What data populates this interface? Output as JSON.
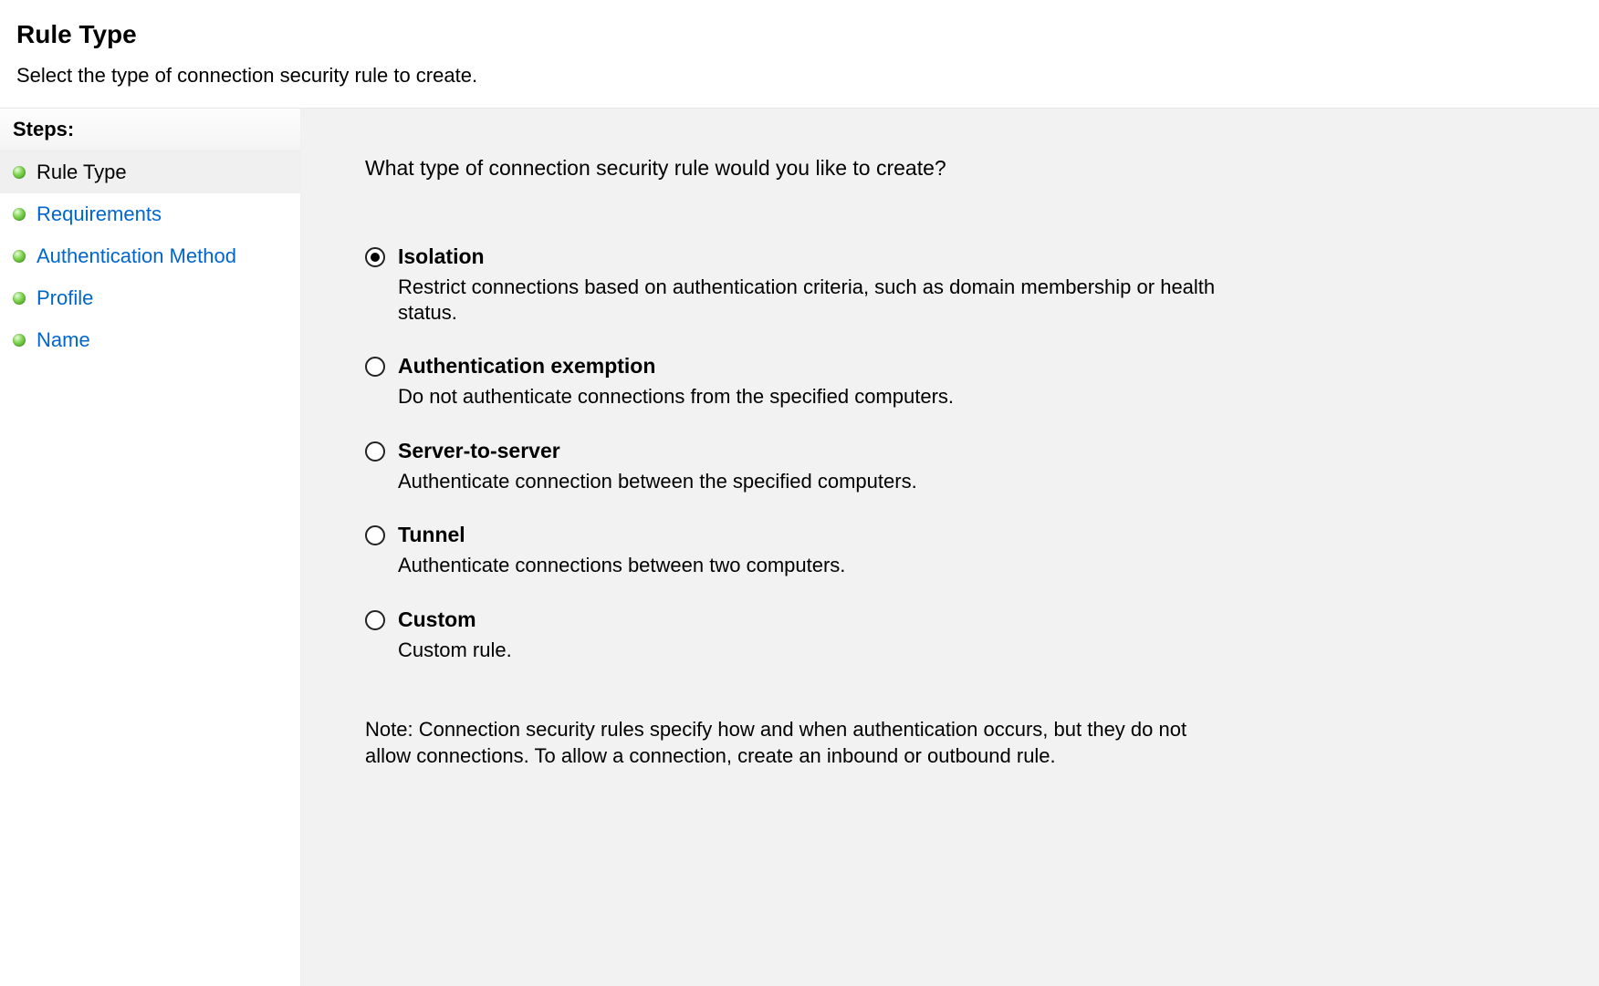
{
  "header": {
    "title": "Rule Type",
    "subtitle": "Select the type of connection security rule to create."
  },
  "sidebar": {
    "heading": "Steps:",
    "items": [
      {
        "label": "Rule Type"
      },
      {
        "label": "Requirements"
      },
      {
        "label": "Authentication Method"
      },
      {
        "label": "Profile"
      },
      {
        "label": "Name"
      }
    ]
  },
  "main": {
    "question": "What type of connection security rule would you like to create?",
    "options": [
      {
        "title": "Isolation",
        "desc": "Restrict connections based on authentication criteria, such as domain membership or health status."
      },
      {
        "title": "Authentication exemption",
        "desc": "Do not authenticate connections from the specified computers."
      },
      {
        "title": "Server-to-server",
        "desc": "Authenticate connection between the specified computers."
      },
      {
        "title": "Tunnel",
        "desc": "Authenticate connections between two computers."
      },
      {
        "title": "Custom",
        "desc": "Custom rule."
      }
    ],
    "note": "Note:  Connection security rules specify how and when authentication occurs, but they do not allow connections.  To allow a connection, create an inbound or outbound rule."
  }
}
